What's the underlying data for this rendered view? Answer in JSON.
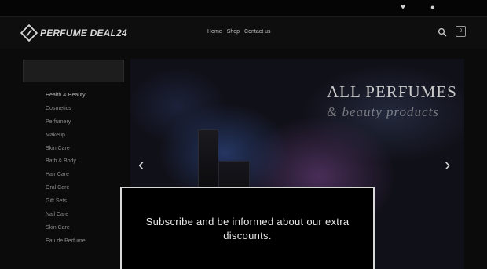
{
  "topbar": {
    "wishlist_icon": "heart-icon",
    "account_icon": "user-icon"
  },
  "header": {
    "logo_text": "PERFUME DEAL24",
    "nav": [
      "Home",
      "Shop",
      "Contact us"
    ],
    "cart_count": "0"
  },
  "sidebar": {
    "items": [
      "Health & Beauty",
      "Cosmetics",
      "Perfumery",
      "Makeup",
      "Skin Care",
      "Bath & Body",
      "Hair Care",
      "Oral Care",
      "Gift Sets",
      "Nail Care",
      "Skin Care",
      "Eau de Perfume"
    ]
  },
  "banner": {
    "title": "ALL PERFUMES",
    "subtitle": "& beauty products"
  },
  "modal": {
    "message": "Subscribe and be informed about our extra discounts."
  },
  "colors": {
    "background": "#0b0b0b",
    "modal_border": "#d9d9d9",
    "text": "#e8e8e8"
  }
}
